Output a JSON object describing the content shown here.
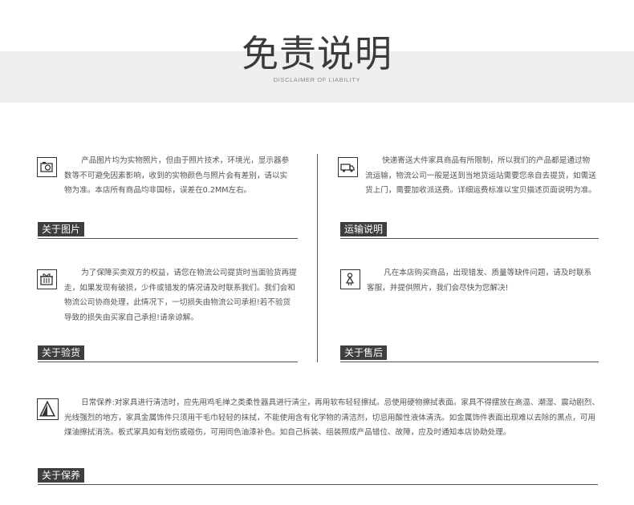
{
  "header": {
    "title": "免责说明",
    "subtitle": "DISCLAIMER OF LIABILITY"
  },
  "sections": {
    "photos": {
      "icon": "camera-icon",
      "text": "产品图片均为实物照片，但由于照片技术，环境光，显示器参数等不可避免因素影响，收到的实物颜色与照片会有差别，请以实物为准。本店所有商品均非国标，误差在0.2MM左右。",
      "label": "关于图片"
    },
    "shipping": {
      "icon": "delivery-truck-icon",
      "text": "快递寄送大件家具商品有所限制，所以我们的产品都是通过物流运输，物流公司一般是送到当地货运站需要您亲自去提货，如需送货上门，需要加收派送费。详细运费标准以宝贝描述页面说明为准。",
      "label": "运输说明"
    },
    "inspection": {
      "icon": "gift-box-icon",
      "text": "为了保障买卖双方的权益，请您在物流公司提货时当面验货再提走，如果发现有破损，少件或错发的情况请及时联系我们。我们会和物流公司协商处理，此情况下，一切损失由物流公司承担!若不验货导致的损失由买家自己承担!请亲谅解。",
      "label": "关于验货"
    },
    "aftersales": {
      "icon": "person-icon",
      "text": "凡在本店购买商品，出现错发、质量等缺件问题，请及时联系客服，并提供照片，我们会尽快为您解决!",
      "label": "关于售后"
    },
    "maintenance": {
      "icon": "warning-triangle-icon",
      "text": "日常保养:对家具进行清洁时，应先用鸡毛掸之类柔性器具进行清尘，再用软布轻轻擦拭。忌使用硬物擦拭表面。家具不得摆放在高温、潮湿、震动剧烈、光线强烈的地方，家具金属饰件只须用干毛巾轻轻的抹拭，不能使用含有化学物的清洁剂，切忌用酸性液体清洗。如金属饰件表面出现难以去除的黑点，可用煤油擦拭消洗。板式家具如有划伤或碰伤，可用同色油漆补色。如自己拆装、组装照成产品错位、故障，应及时通知本店协助处理。",
      "label": "关于保养"
    }
  }
}
